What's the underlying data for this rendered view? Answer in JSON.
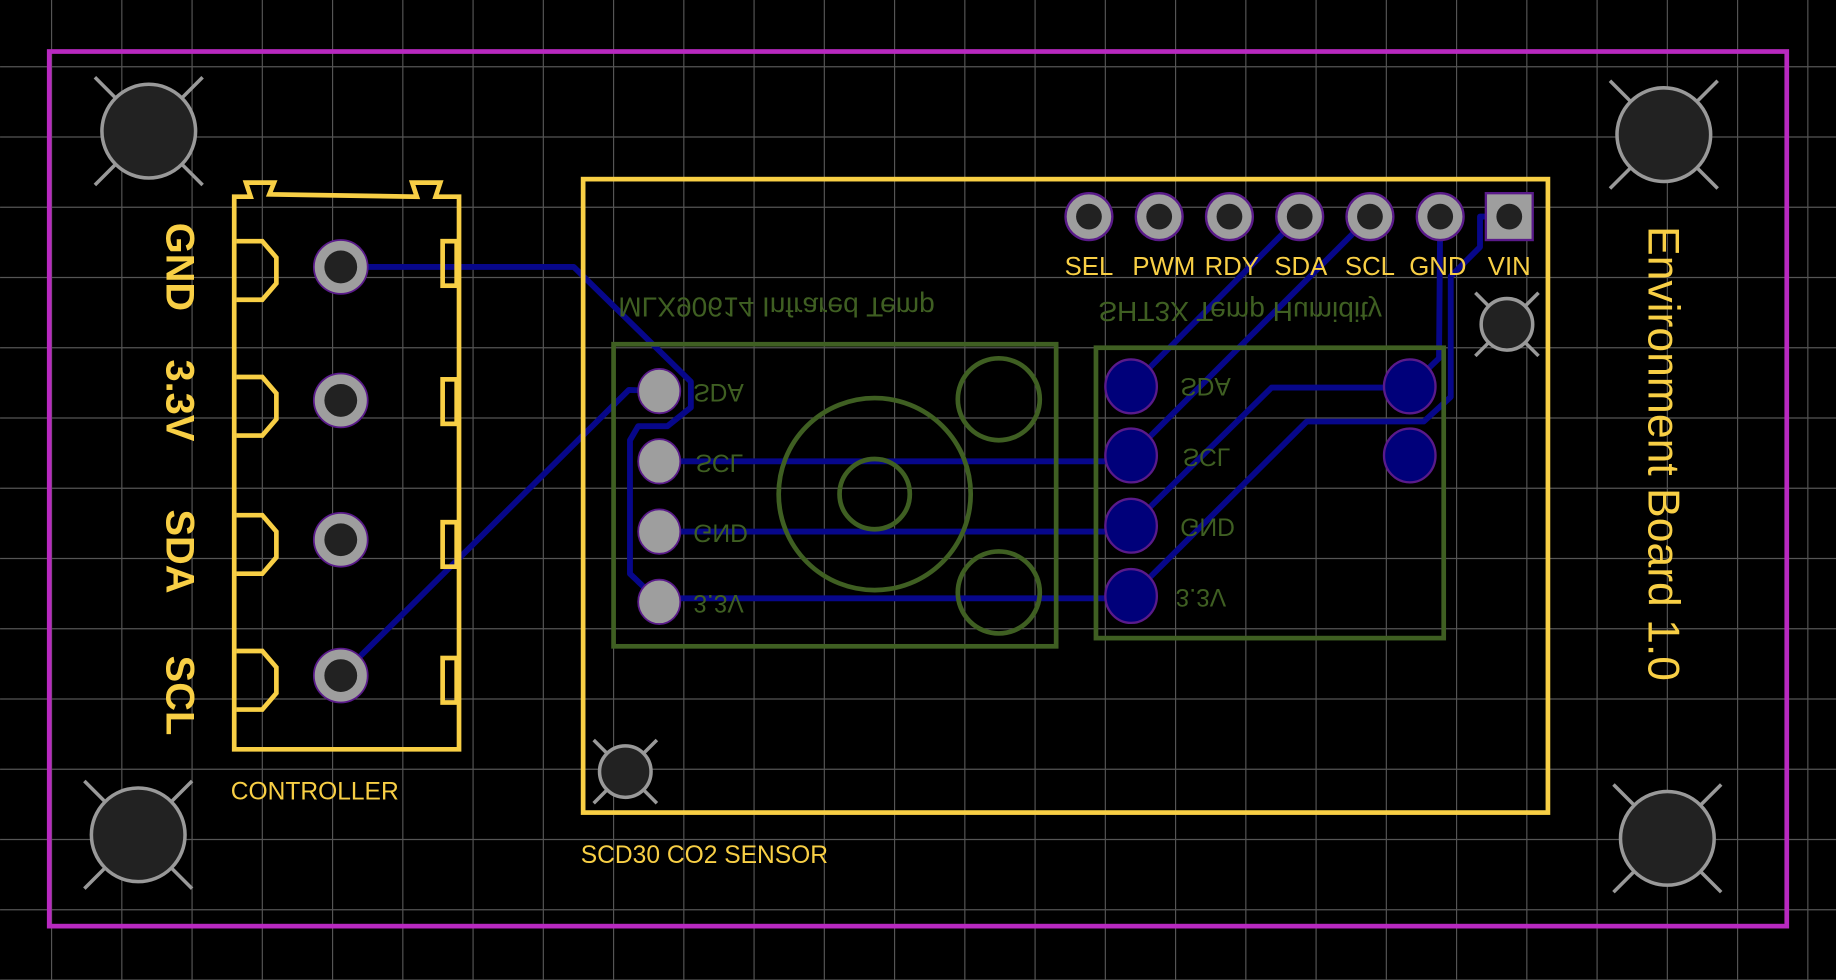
{
  "colors": {
    "background": "#000000",
    "grid": "#555555",
    "board_outline": "#b829c0",
    "top_silkscreen": "#f8cf45",
    "bottom_silkscreen": "#3f5f22",
    "trace": "#07078a",
    "pad": "#9e9e9e",
    "pad_hole": "#222222",
    "smd_pad": "#00007a"
  },
  "board": {
    "title": "Environment Board 1.0"
  },
  "controller": {
    "label": "CONTROLLER",
    "pins": [
      "GND",
      "3.3V",
      "SDA",
      "SCL"
    ]
  },
  "scd30": {
    "label": "SCD30 CO2 SENSOR",
    "pins": [
      "SEL",
      "PWM",
      "RDY",
      "SDA",
      "SCL",
      "GND",
      "VIN"
    ]
  },
  "mlx": {
    "title": "MLX90614 Infrared Temp",
    "pins": [
      "SDA",
      "SCL",
      "GND",
      "3.3V"
    ]
  },
  "sht": {
    "title": "SHT3X Temp Humidity",
    "pins": [
      "SDA",
      "SCL",
      "GND",
      "3.3V"
    ]
  }
}
